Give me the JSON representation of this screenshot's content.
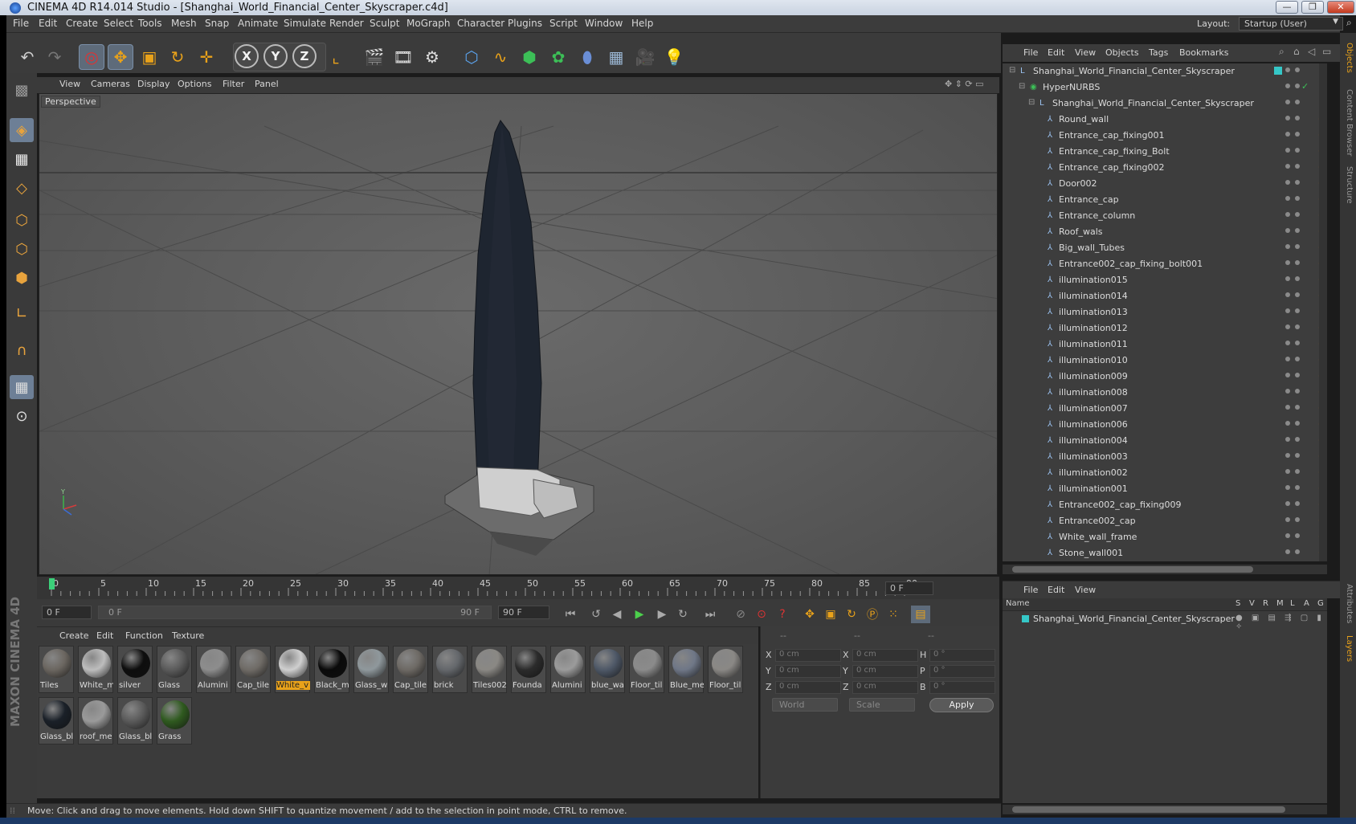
{
  "window": {
    "title": "CINEMA 4D R14.014 Studio - [Shanghai_World_Financial_Center_Skyscraper.c4d]",
    "controls": [
      "minimize",
      "restore",
      "close"
    ]
  },
  "menubar": {
    "items": [
      "File",
      "Edit",
      "Create",
      "Select",
      "Tools",
      "Mesh",
      "Snap",
      "Animate",
      "Simulate",
      "Render",
      "Sculpt",
      "MoGraph",
      "Character",
      "Plugins",
      "Script",
      "Window",
      "Help"
    ],
    "layout_label": "Layout:",
    "layout_value": "Startup (User)"
  },
  "toolbar": {
    "tools": [
      "undo-icon",
      "redo-icon",
      "live-selection-icon",
      "move-icon",
      "scale-icon",
      "rotate-icon",
      "create-icon",
      "x-axis-icon",
      "y-axis-icon",
      "z-axis-icon",
      "world-coordinates-icon",
      "render-view-icon",
      "render-picture-viewer-icon",
      "render-settings-icon",
      "cube-icon",
      "spline-icon",
      "nurbs-icon",
      "array-icon",
      "deformer-icon",
      "floor-icon",
      "camera-icon",
      "light-icon"
    ],
    "axes": [
      "X",
      "Y",
      "Z"
    ]
  },
  "viewport": {
    "menu": [
      "View",
      "Cameras",
      "Display",
      "Options",
      "Filter",
      "Panel"
    ],
    "label": "Perspective"
  },
  "timeline": {
    "ticks": [
      "0",
      "5",
      "10",
      "15",
      "20",
      "25",
      "30",
      "35",
      "40",
      "45",
      "50",
      "55",
      "60",
      "65",
      "70",
      "75",
      "80",
      "85",
      "90"
    ],
    "current_frame": "0 F",
    "start_frame": "0 F",
    "range_start": "0 F",
    "range_end": "90 F",
    "end_frame": "90 F"
  },
  "materials": {
    "menu": [
      "Create",
      "Edit",
      "Function",
      "Texture"
    ],
    "items": [
      {
        "name": "Tiles",
        "color": "#6b6660"
      },
      {
        "name": "White_m",
        "color": "#bdbdbd"
      },
      {
        "name": "silver",
        "color": "#0e0e0e"
      },
      {
        "name": "Glass",
        "color": "#5b5b5b"
      },
      {
        "name": "Alumini",
        "color": "#8d8d8d"
      },
      {
        "name": "Cap_tile",
        "color": "#6f6b66"
      },
      {
        "name": "White_v",
        "color": "#cfcfcf"
      },
      {
        "name": "Black_m",
        "color": "#0a0a0a"
      },
      {
        "name": "Glass_w",
        "color": "#8f989c"
      },
      {
        "name": "Cap_tile",
        "color": "#6d6964"
      },
      {
        "name": "brick",
        "color": "#64676b"
      },
      {
        "name": "Tiles002",
        "color": "#8a8884"
      },
      {
        "name": "Founda",
        "color": "#2b2b2b"
      },
      {
        "name": "Alumini",
        "color": "#9b9b9b"
      },
      {
        "name": "blue_wa",
        "color": "#4e5867"
      },
      {
        "name": "Floor_til",
        "color": "#8b8b8b"
      },
      {
        "name": "Blue_me",
        "color": "#6f7787"
      },
      {
        "name": "Floor_til",
        "color": "#8a8885"
      },
      {
        "name": "Glass_bl",
        "color": "#1a2028"
      },
      {
        "name": "roof_me",
        "color": "#9a9a9a"
      },
      {
        "name": "Glass_bl",
        "color": "#5a5a5a"
      },
      {
        "name": "Grass",
        "color": "#2f5a1f"
      }
    ],
    "selected_index": 6
  },
  "coordinates": {
    "headers": [
      "--",
      "--",
      "--"
    ],
    "rows": [
      {
        "a": "X",
        "av": "0 cm",
        "b": "X",
        "bv": "0 cm",
        "c": "H",
        "cv": "0 °"
      },
      {
        "a": "Y",
        "av": "0 cm",
        "b": "Y",
        "bv": "0 cm",
        "c": "P",
        "cv": "0 °"
      },
      {
        "a": "Z",
        "av": "0 cm",
        "b": "Z",
        "bv": "0 cm",
        "c": "B",
        "cv": "0 °"
      }
    ],
    "mode": "World",
    "transform": "Scale",
    "apply": "Apply"
  },
  "status": {
    "text": "Move: Click and drag to move elements. Hold down SHIFT to quantize movement / add to the selection in point mode, CTRL to remove."
  },
  "objects": {
    "menu": [
      "File",
      "Edit",
      "View",
      "Objects",
      "Tags",
      "Bookmarks"
    ],
    "tree": [
      {
        "name": "Shanghai_World_Financial_Center_Skyscraper",
        "level": 0,
        "icon": "null-icon"
      },
      {
        "name": "HyperNURBS",
        "level": 1,
        "icon": "hypernurbs-icon"
      },
      {
        "name": "Shanghai_World_Financial_Center_Skyscraper",
        "level": 2,
        "icon": "null-icon"
      },
      {
        "name": "Round_wall",
        "level": 3,
        "icon": "polygon-icon"
      },
      {
        "name": "Entrance_cap_fixing001",
        "level": 3,
        "icon": "polygon-icon"
      },
      {
        "name": "Entrance_cap_fixing_Bolt",
        "level": 3,
        "icon": "polygon-icon"
      },
      {
        "name": "Entrance_cap_fixing002",
        "level": 3,
        "icon": "polygon-icon"
      },
      {
        "name": "Door002",
        "level": 3,
        "icon": "polygon-icon"
      },
      {
        "name": "Entrance_cap",
        "level": 3,
        "icon": "polygon-icon"
      },
      {
        "name": "Entrance_column",
        "level": 3,
        "icon": "polygon-icon"
      },
      {
        "name": "Roof_wals",
        "level": 3,
        "icon": "polygon-icon"
      },
      {
        "name": "Big_wall_Tubes",
        "level": 3,
        "icon": "polygon-icon"
      },
      {
        "name": "Entrance002_cap_fixing_bolt001",
        "level": 3,
        "icon": "polygon-icon"
      },
      {
        "name": "illumination015",
        "level": 3,
        "icon": "polygon-icon"
      },
      {
        "name": "illumination014",
        "level": 3,
        "icon": "polygon-icon"
      },
      {
        "name": "illumination013",
        "level": 3,
        "icon": "polygon-icon"
      },
      {
        "name": "illumination012",
        "level": 3,
        "icon": "polygon-icon"
      },
      {
        "name": "illumination011",
        "level": 3,
        "icon": "polygon-icon"
      },
      {
        "name": "illumination010",
        "level": 3,
        "icon": "polygon-icon"
      },
      {
        "name": "illumination009",
        "level": 3,
        "icon": "polygon-icon"
      },
      {
        "name": "illumination008",
        "level": 3,
        "icon": "polygon-icon"
      },
      {
        "name": "illumination007",
        "level": 3,
        "icon": "polygon-icon"
      },
      {
        "name": "illumination006",
        "level": 3,
        "icon": "polygon-icon"
      },
      {
        "name": "illumination004",
        "level": 3,
        "icon": "polygon-icon"
      },
      {
        "name": "illumination003",
        "level": 3,
        "icon": "polygon-icon"
      },
      {
        "name": "illumination002",
        "level": 3,
        "icon": "polygon-icon"
      },
      {
        "name": "illumination001",
        "level": 3,
        "icon": "polygon-icon"
      },
      {
        "name": "Entrance002_cap_fixing009",
        "level": 3,
        "icon": "polygon-icon"
      },
      {
        "name": "Entrance002_cap",
        "level": 3,
        "icon": "polygon-icon"
      },
      {
        "name": "White_wall_frame",
        "level": 3,
        "icon": "polygon-icon"
      },
      {
        "name": "Stone_wall001",
        "level": 3,
        "icon": "polygon-icon"
      }
    ]
  },
  "side_tabs": [
    "Objects",
    "Content Browser",
    "Structure",
    "Attributes",
    "Layers"
  ],
  "layers": {
    "menu": [
      "File",
      "Edit",
      "View"
    ],
    "headers": [
      "Name",
      "S",
      "V",
      "R",
      "M",
      "L",
      "A",
      "G"
    ],
    "rows": [
      {
        "name": "Shanghai_World_Financial_Center_Skyscraper",
        "color": "#35c7c7"
      }
    ]
  },
  "branding": {
    "logo": "MAXON CINEMA 4D"
  },
  "colors": {
    "accent": "#e9a21a",
    "background": "#3b3b3b",
    "selection": "#6d7f96"
  }
}
